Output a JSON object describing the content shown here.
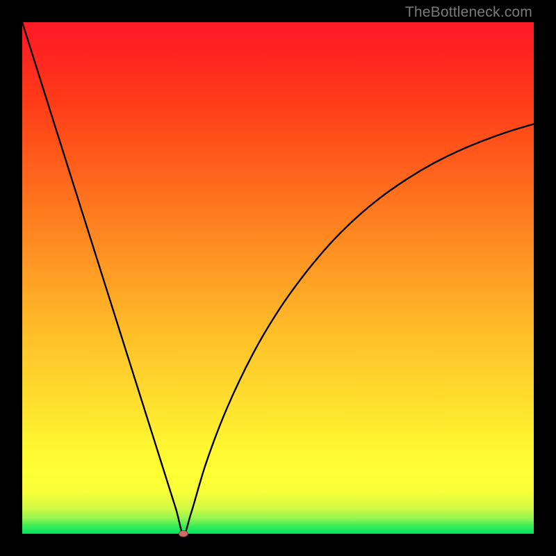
{
  "watermark": "TheBottleneck.com",
  "chart_data": {
    "type": "line",
    "title": "",
    "xlabel": "",
    "ylabel": "",
    "xlim": [
      0,
      100
    ],
    "ylim": [
      0,
      100
    ],
    "grid": false,
    "legend": false,
    "series": [
      {
        "name": "bottleneck-curve",
        "x": [
          0,
          3,
          6,
          9,
          12,
          15,
          18,
          21,
          24,
          27,
          30,
          31.5,
          33,
          36,
          40,
          45,
          50,
          55,
          60,
          65,
          70,
          75,
          80,
          85,
          90,
          95,
          100
        ],
        "y": [
          100,
          90.5,
          81,
          71.5,
          62,
          52.5,
          43,
          33.5,
          24,
          14.5,
          5,
          0,
          4,
          14,
          24.5,
          35,
          43.5,
          50.5,
          56.5,
          61.5,
          65.7,
          69.2,
          72.2,
          74.7,
          76.8,
          78.6,
          80.1
        ]
      }
    ],
    "annotations": [
      {
        "name": "minimum-marker",
        "x": 31.5,
        "y": 0
      }
    ],
    "background_gradient": {
      "top": "#ff1a28",
      "upper_mid": "#ffae26",
      "mid": "#ffff33",
      "lower_mid": "#d3fb44",
      "bottom": "#00e65c"
    }
  }
}
